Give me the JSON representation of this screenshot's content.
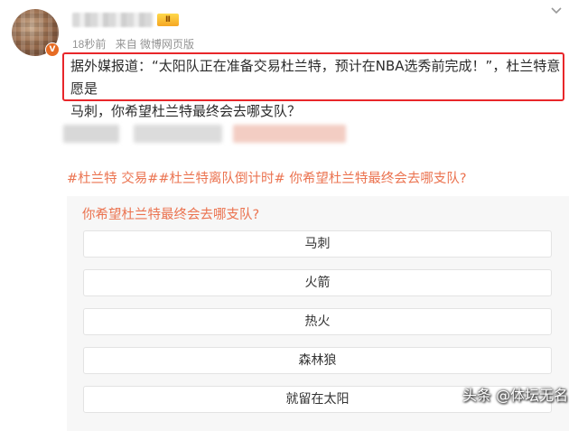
{
  "header": {
    "level_badge": "Ⅱ",
    "verified_badge": "V",
    "time": "18秒前",
    "source": "来自 微博网页版"
  },
  "post": {
    "text_line1": "据外媒报道：“太阳队正在准备交易杜兰特，预计在NBA选秀前完成！”，杜兰特意愿是",
    "text_line2": "马刺，你希望杜兰特最终会去哪支队？",
    "topics": "#杜兰特 交易##杜兰特离队倒计时# 你希望杜兰特最终会去哪支队?"
  },
  "poll": {
    "title": "你希望杜兰特最终会去哪支队?",
    "options": [
      "马刺",
      "火箭",
      "热火",
      "森林狼",
      "就留在太阳"
    ]
  },
  "watermark": "头条 @体坛无名",
  "colors": {
    "accent": "#eb7350",
    "highlight_border": "#e8262a",
    "meta_gray": "#939393",
    "poll_bg": "#f7f7f7"
  },
  "icons": {
    "more": "chevron-down-icon",
    "verified": "verified-badge-icon"
  }
}
